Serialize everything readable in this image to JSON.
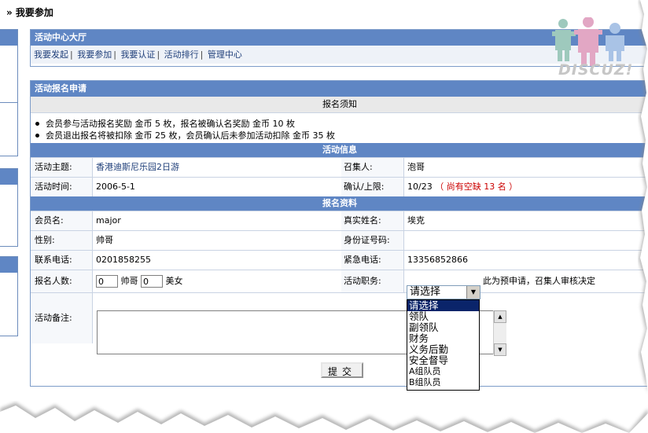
{
  "page_title": "» 我要参加",
  "logo_text": "DISCUZ!",
  "center": {
    "title": "活动中心大厅",
    "nav": [
      "我要发起",
      "我要参加",
      "我要认证",
      "活动排行",
      "管理中心"
    ]
  },
  "form": {
    "title": "活动报名申请",
    "notice_title": "报名须知",
    "notices": [
      "会员参与活动报名奖励 金币 5 枚，报名被确认名奖励 金币 10 枚",
      "会员退出报名将被扣除 金币 25 枚，会员确认后未参加活动扣除 金币 35 枚"
    ],
    "info_title": "活动信息",
    "info": {
      "subject_label": "活动主题:",
      "subject_value": "香港迪斯尼乐园2日游",
      "organizer_label": "召集人:",
      "organizer_value": "泡哥",
      "time_label": "活动时间:",
      "time_value": "2006-5-1",
      "limit_label": "确认/上限:",
      "limit_value": "10/23",
      "limit_note": "（ 尚有空缺  13 名 ）"
    },
    "profile_title": "报名资料",
    "profile": {
      "member_label": "会员名:",
      "member_value": "major",
      "realname_label": "真实姓名:",
      "realname_value": "埃克",
      "gender_label": "性别:",
      "gender_value": "帅哥",
      "id_label": "身份证号码:",
      "id_value": "",
      "phone_label": "联系电话:",
      "phone_value": "0201858255",
      "emergency_label": "紧急电话:",
      "emergency_value": "13356852866",
      "count_label": "报名人数:",
      "male_count": "0",
      "male_label": "帅哥",
      "female_count": "0",
      "female_label": "美女",
      "role_label": "活动职务:",
      "role_selected": "请选择",
      "role_hint": "此为预申请，召集人审核决定",
      "role_options": [
        "请选择",
        "领队",
        "副领队",
        "财务",
        "义务后勤",
        "安全督导",
        "A组队员",
        "B组队员"
      ],
      "remark_label": "活动备注:",
      "remark_value": ""
    },
    "submit_label": "提交"
  }
}
